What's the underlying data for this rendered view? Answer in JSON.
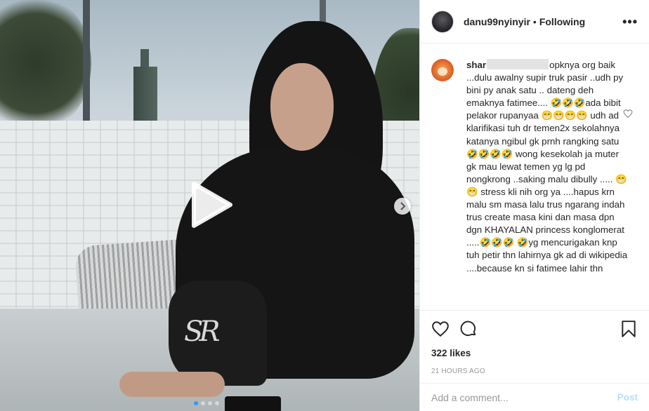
{
  "header": {
    "username": "danu99nyinyir",
    "separator": "•",
    "follow_status": "Following",
    "more_icon": "more-horizontal-icon"
  },
  "comment": {
    "username_visible_start": "shar",
    "username_redacted": true,
    "text_after_redaction": "opknya org baik ...dulu awalny supir truk pasir ..udh py bini py anak satu .. dateng deh emaknya fatimee.... 🤣🤣🤣ada bibit pelakor rupanyaa 😁😁😁😁 udh ad klarifikasi tuh dr temen2x sekolahnya katanya ngibul gk prnh rangking satu 🤣🤣🤣🤣 wong kesekolah ja muter gk mau lewat temen yg lg pd nongkrong ..saking malu dibully ..... 😁😁 stress kli nih org ya ....hapus krn malu sm masa lalu trus ngarang indah trus create masa kini dan masa dpn dgn KHAYALAN princess konglomerat .....🤣🤣🤣 🤣yg mencurigakan knp tuh petir thn lahirnya gk ad di wikipedia ....because kn si fatimee lahir thn"
  },
  "media": {
    "type": "video",
    "play_icon": "play-icon",
    "next_icon": "chevron-right-icon",
    "carousel_count": 4,
    "carousel_active_index": 0,
    "monogram": "SR"
  },
  "actions": {
    "like_icon": "heart-outline-icon",
    "comment_icon": "comment-bubble-icon",
    "save_icon": "bookmark-icon",
    "likes": "322 likes",
    "timestamp": "21 HOURS AGO"
  },
  "add_comment": {
    "placeholder": "Add a comment...",
    "post_label": "Post"
  },
  "colors": {
    "accent": "#3897f0",
    "post_disabled": "#b2dffc",
    "text": "#262626",
    "muted": "#999999",
    "border": "#efefef"
  }
}
